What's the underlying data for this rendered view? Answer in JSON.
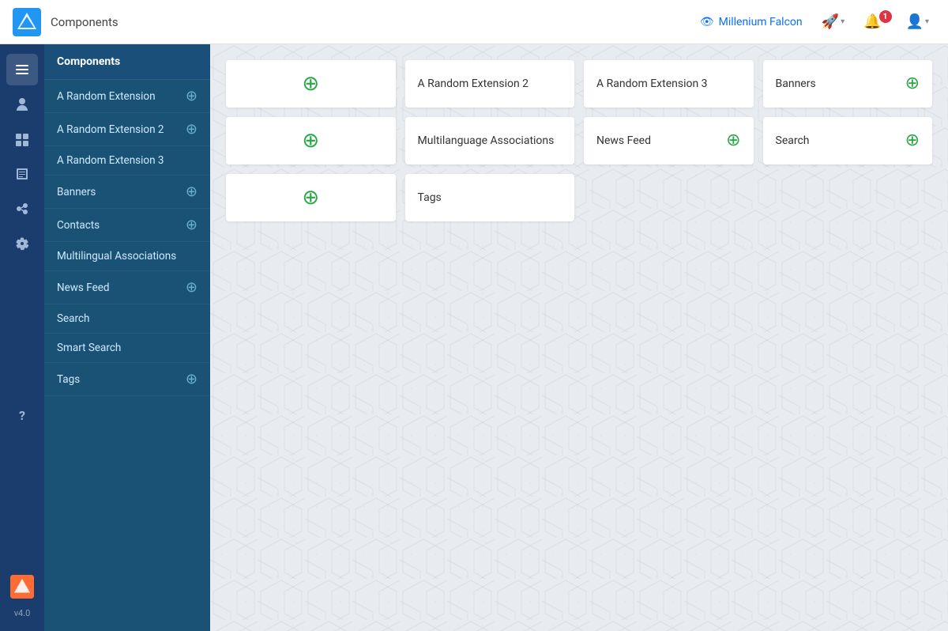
{
  "topbar": {
    "title": "Components",
    "user_label": "Millenium Falcon",
    "notification_count": "1"
  },
  "icon_sidebar": {
    "items": [
      {
        "name": "toggle-icon",
        "icon": "☰",
        "active": true
      },
      {
        "name": "users-icon",
        "icon": "👥",
        "active": false
      },
      {
        "name": "menu-icon",
        "icon": "≡",
        "active": false
      },
      {
        "name": "content-icon",
        "icon": "📄",
        "active": false
      },
      {
        "name": "components-icon",
        "icon": "⊞",
        "active": false
      },
      {
        "name": "settings-icon",
        "icon": "⚙",
        "active": false
      },
      {
        "name": "help-icon",
        "icon": "?",
        "active": false
      }
    ],
    "bottom": {
      "logo_label": "v4.0"
    }
  },
  "nav_sidebar": {
    "header": "Components",
    "items": [
      {
        "label": "A Random Extension",
        "has_plus": true
      },
      {
        "label": "A Random Extension 2",
        "has_plus": true
      },
      {
        "label": "A Random Extension 3",
        "has_plus": false
      },
      {
        "label": "Banners",
        "has_plus": true
      },
      {
        "label": "Contacts",
        "has_plus": true
      },
      {
        "label": "Multilingual Associations",
        "has_plus": false
      },
      {
        "label": "News Feed",
        "has_plus": true
      },
      {
        "label": "Search",
        "has_plus": false
      },
      {
        "label": "Smart Search",
        "has_plus": false
      },
      {
        "label": "Tags",
        "has_plus": true
      }
    ]
  },
  "content": {
    "cards": [
      [
        {
          "type": "plus-only",
          "label": ""
        },
        {
          "type": "labeled",
          "label": "A Random Extension 2",
          "has_plus": false
        },
        {
          "type": "labeled",
          "label": "A Random Extension 3",
          "has_plus": false
        },
        {
          "type": "labeled",
          "label": "Banners",
          "has_plus": true
        }
      ],
      [
        {
          "type": "plus-only",
          "label": ""
        },
        {
          "type": "labeled",
          "label": "Multilanguage Associations",
          "has_plus": false
        },
        {
          "type": "labeled",
          "label": "News Feed",
          "has_plus": true
        },
        {
          "type": "labeled",
          "label": "Search",
          "has_plus": true
        }
      ],
      [
        {
          "type": "plus-only",
          "label": ""
        },
        {
          "type": "labeled",
          "label": "Tags",
          "has_plus": false
        },
        {
          "type": "empty",
          "label": ""
        },
        {
          "type": "empty",
          "label": ""
        }
      ]
    ]
  }
}
